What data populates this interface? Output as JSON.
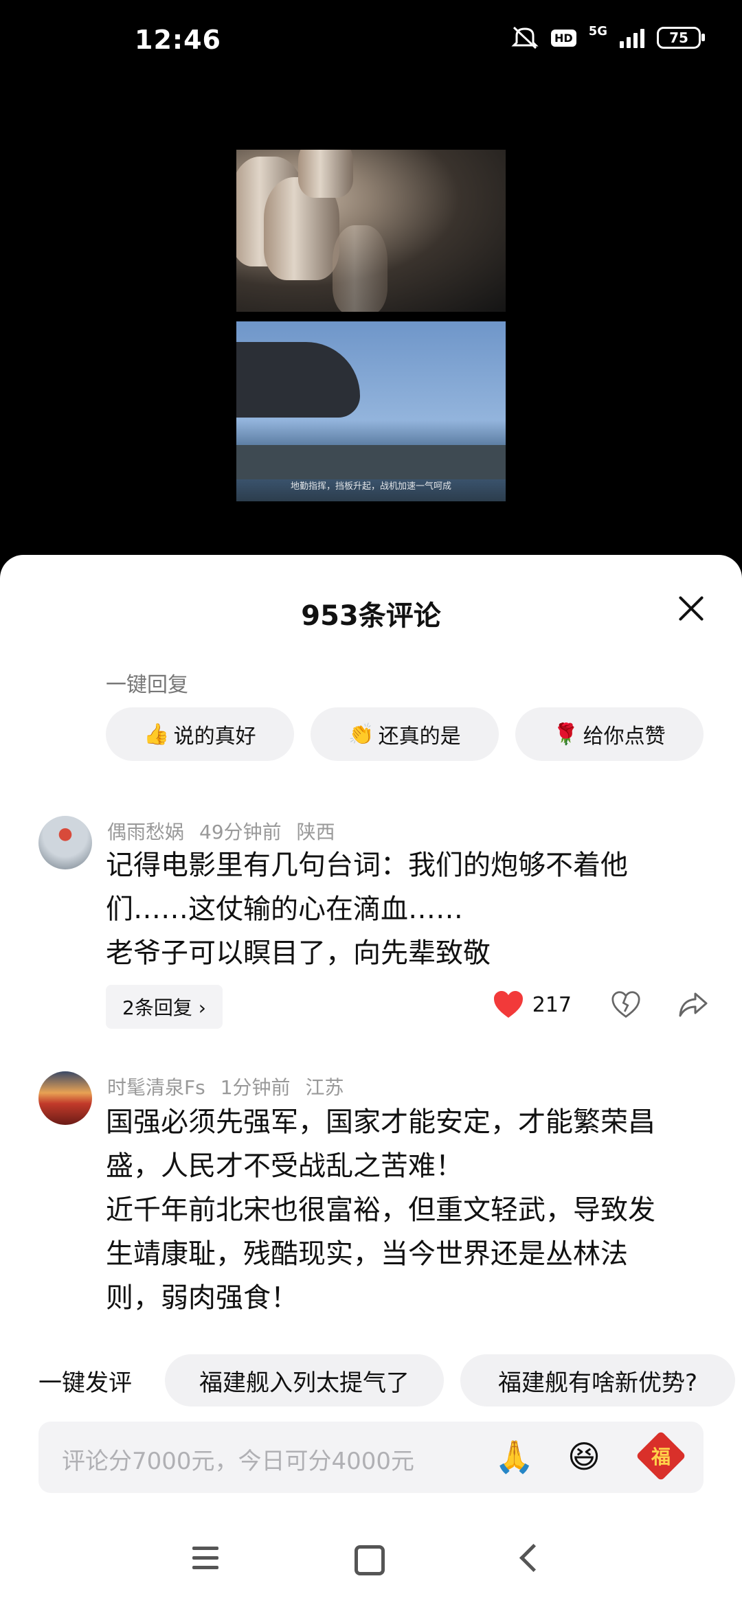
{
  "status_bar": {
    "time": "12:46",
    "hd": "HD",
    "network": "5G",
    "battery": "75"
  },
  "video": {
    "subtitle": "地勤指挥，挡板升起，战机加速一气呵成"
  },
  "sheet": {
    "title": "953条评论",
    "quick_reply_label": "一键回复",
    "quick_replies": [
      {
        "emoji": "👍",
        "text": "说的真好"
      },
      {
        "emoji": "👏",
        "text": "还真的是"
      },
      {
        "emoji": "🌹",
        "text": "给你点赞"
      }
    ]
  },
  "comments": [
    {
      "user": "偶雨愁娲",
      "time": "49分钟前",
      "location": "陕西",
      "lines": [
        "记得电影里有几句台词：我们的炮够不着他",
        "们……这仗输的心在滴血……",
        "老爷子可以瞑目了，向先辈致敬"
      ],
      "replies_label": "2条回复 ›",
      "likes": "217"
    },
    {
      "user": "时髦清泉Fs",
      "time": "1分钟前",
      "location": "江苏",
      "lines": [
        "国强必须先强军，国家才能安定，才能繁荣昌",
        "盛，人民才不受战乱之苦难！",
        "近千年前北宋也很富裕，但重文轻武，导致发",
        "生靖康耻，残酷现实，当今世界还是丛林法",
        "则，弱肉强食！"
      ]
    }
  ],
  "bottom": {
    "onekey_label": "一键发评",
    "suggestions": [
      "福建舰入列太提气了",
      "福建舰有啥新优势?"
    ],
    "input_placeholder": "评论分7000元，今日可分4000元",
    "emoji_1": "🙏",
    "emoji_2": "😆",
    "fu_label": "福"
  },
  "colors": {
    "like_red": "#f23a3a",
    "sheet_bg": "#ffffff",
    "chip_bg": "#f1f1f3"
  }
}
